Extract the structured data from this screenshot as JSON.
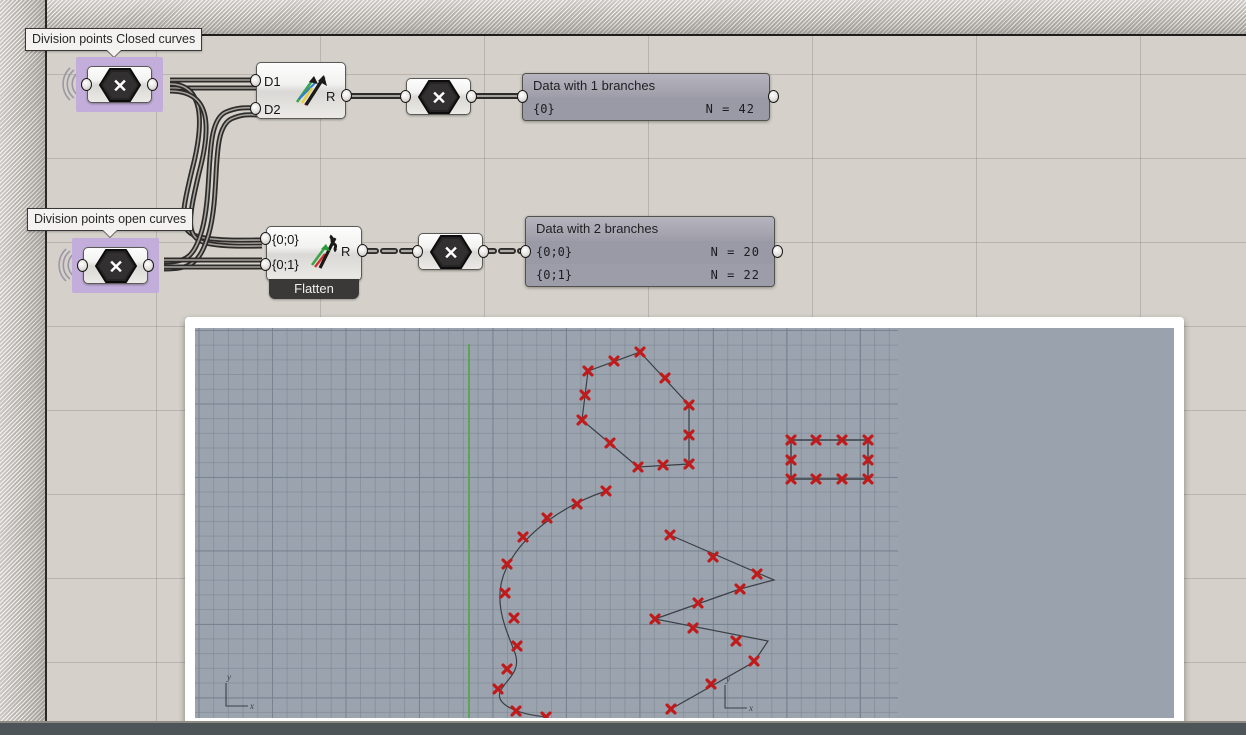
{
  "app": {
    "name": "Grasshopper canvas with Rhino viewport"
  },
  "canvas": {
    "labels": [
      {
        "id": "closed",
        "text": "Division points Closed curves"
      },
      {
        "id": "open",
        "text": "Division points open curves"
      }
    ],
    "components": [
      {
        "id": "merge-top",
        "icon": "merge-hexagon-icon",
        "selected": true,
        "inputs": [],
        "outputs": [
          ""
        ]
      },
      {
        "id": "relative-differences-top",
        "icon": "vector-display-icon",
        "inputs": [
          "D1",
          "D2"
        ],
        "outputs": [
          "R"
        ]
      },
      {
        "id": "merge-mid-top",
        "icon": "merge-hexagon-icon",
        "inputs": [],
        "outputs": [
          ""
        ]
      },
      {
        "id": "merge-bottom",
        "icon": "merge-hexagon-icon",
        "selected": true,
        "inputs": [],
        "outputs": [
          ""
        ]
      },
      {
        "id": "relative-differences-bottom",
        "icon": "vector-display-icon",
        "inputs": [
          "{0;0}",
          "{0;1}"
        ],
        "outputs": [
          "R"
        ],
        "tag": "Flatten"
      },
      {
        "id": "merge-mid-bottom",
        "icon": "merge-hexagon-icon",
        "inputs": [],
        "outputs": [
          ""
        ]
      }
    ],
    "panels": [
      {
        "id": "panel-1-branch",
        "title": "Data with 1 branches",
        "rows": [
          {
            "path": "{0}",
            "count": "N  =  42"
          }
        ]
      },
      {
        "id": "panel-2-branches",
        "title": "Data with 2 branches",
        "rows": [
          {
            "path": "{0;0}",
            "count": "N  =  20"
          },
          {
            "path": "{0;1}",
            "count": "N  =  22"
          }
        ]
      }
    ],
    "colors": {
      "canvas_background": "#d5d1ca",
      "selection_highlight": "#c3aedb",
      "wire_stroke": "#3c3a37",
      "panel_fill": "#9a99a6",
      "tag_fill": "#3a3937"
    }
  },
  "viewport": {
    "name": "rhino-top-viewport",
    "background": "#9aa3ad",
    "axis_colors": {
      "x": "#b05a55",
      "y": "#5aa55a"
    },
    "gizmos": [
      {
        "id": "origin-gizmo",
        "x_label": "x",
        "y_label": "y"
      },
      {
        "id": "secondary-gizmo",
        "x_label": "x",
        "y_label": "y"
      }
    ],
    "point_marker": {
      "shape": "x-cross",
      "color": "#c01a1a",
      "size": 9
    },
    "curve_color": "#3b3f45",
    "geometry": [
      {
        "id": "hexagon-closed-curve",
        "kind": "closed-polygon",
        "divisions": 12,
        "points": [
          [
            630,
            341
          ],
          [
            659,
            359
          ],
          [
            679,
            394
          ],
          [
            679,
            423
          ],
          [
            661,
            450
          ],
          [
            629,
            452
          ],
          [
            601,
            442
          ],
          [
            578,
            409
          ],
          [
            572,
            378
          ],
          [
            593,
            360
          ],
          [
            612,
            345
          ],
          [
            645,
            349
          ]
        ]
      },
      {
        "id": "rectangle-closed-curve",
        "kind": "closed-rectangle",
        "divisions": 10,
        "points": [
          [
            781,
            429
          ],
          [
            805,
            429
          ],
          [
            833,
            429
          ],
          [
            858,
            429
          ],
          [
            858,
            447
          ],
          [
            858,
            468
          ],
          [
            833,
            468
          ],
          [
            805,
            468
          ],
          [
            781,
            468
          ],
          [
            781,
            447
          ]
        ]
      },
      {
        "id": "s-curve-open",
        "kind": "open-spline",
        "divisions": 20,
        "points": [
          [
            596,
            480
          ],
          [
            568,
            492
          ],
          [
            537,
            505
          ],
          [
            513,
            524
          ],
          [
            497,
            551
          ],
          [
            494,
            580
          ],
          [
            496,
            600
          ],
          [
            505,
            620
          ],
          [
            506,
            641
          ],
          [
            498,
            659
          ],
          [
            486,
            675
          ],
          [
            490,
            690
          ],
          [
            510,
            703
          ],
          [
            537,
            706
          ]
        ]
      },
      {
        "id": "zigzag-open",
        "kind": "open-polyline",
        "divisions": 22,
        "points": [
          [
            660,
            524
          ],
          [
            703,
            546
          ],
          [
            747,
            562
          ],
          [
            764,
            569
          ],
          [
            730,
            577
          ],
          [
            690,
            592
          ],
          [
            645,
            608
          ],
          [
            683,
            617
          ],
          [
            727,
            630
          ],
          [
            758,
            641
          ],
          [
            744,
            650
          ],
          [
            702,
            673
          ],
          [
            661,
            698
          ]
        ]
      }
    ]
  }
}
